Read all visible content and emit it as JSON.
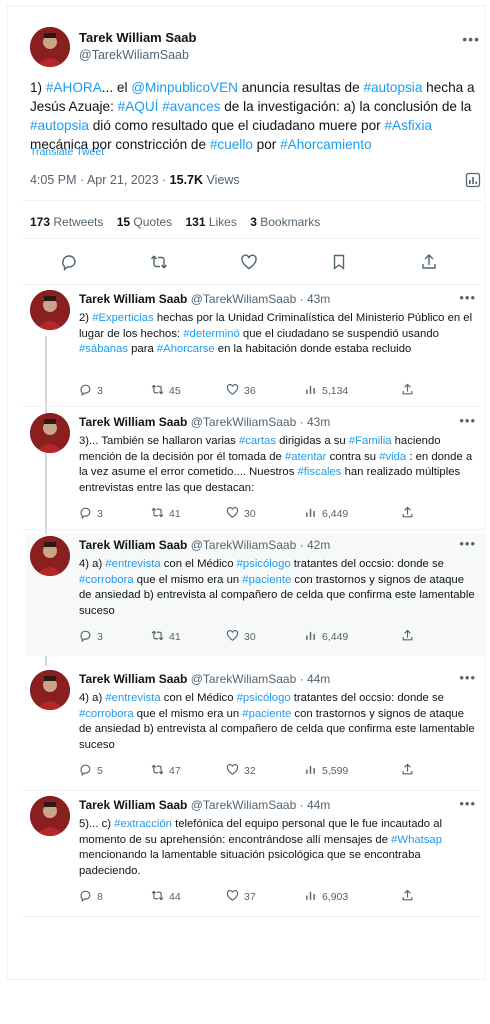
{
  "colors": {
    "accent": "#1d9bf0",
    "secondary_text": "#536471",
    "text": "#0f1419",
    "divider": "#eff3f4",
    "avatar": "#7a1d1d"
  },
  "main_tweet": {
    "author_name": "Tarek William Saab",
    "author_handle": "@TarekWiliamSaab",
    "more_icon": "ellipsis-icon",
    "text_parts": [
      {
        "t": "1) ",
        "h": false
      },
      {
        "t": "#AHORA",
        "h": true
      },
      {
        "t": "... el ",
        "h": false
      },
      {
        "t": "@MinpublicoVEN",
        "h": true
      },
      {
        "t": " anuncia resultas de ",
        "h": false
      },
      {
        "t": "#autopsia",
        "h": true
      },
      {
        "t": " hecha a Jesús Azuaje: ",
        "h": false
      },
      {
        "t": "#AQUÍ",
        "h": true
      },
      {
        "t": " ",
        "h": false
      },
      {
        "t": "#avances",
        "h": true
      },
      {
        "t": " de la investigación: a) la conclusión de la ",
        "h": false
      },
      {
        "t": "#autopsia",
        "h": true
      },
      {
        "t": " dió como resultado que el ciudadano muere por ",
        "h": false
      },
      {
        "t": "#Asfixia",
        "h": true
      },
      {
        "t": " mecánica por constricción de ",
        "h": false
      },
      {
        "t": "#cuello",
        "h": true
      },
      {
        "t": " por ",
        "h": false
      },
      {
        "t": "#Ahorcamiento",
        "h": true
      }
    ],
    "translate_label": "Translate Tweet",
    "time": "4:05 PM · Apr 21, 2023 · ",
    "views_count": "15.7K",
    "views_label": " Views",
    "stats": {
      "retweets_count": "173",
      "retweets_label": " Retweets",
      "quotes_count": "15",
      "quotes_label": " Quotes",
      "likes_count": "131",
      "likes_label": " Likes",
      "bookmarks_count": "3",
      "bookmarks_label": " Bookmarks"
    }
  },
  "replies": [
    {
      "name": "Tarek William Saab",
      "handle": "@TarekWiliamSaab · 43m",
      "text_parts": [
        {
          "t": "2) ",
          "h": false
        },
        {
          "t": "#Experticias",
          "h": true
        },
        {
          "t": " hechas por la Unidad Criminalística del Ministerio Público en el lugar de los hechos: ",
          "h": false
        },
        {
          "t": "#determinó",
          "h": true
        },
        {
          "t": " que el ciudadano se suspendió usando ",
          "h": false
        },
        {
          "t": "#sábanas",
          "h": true
        },
        {
          "t": " para ",
          "h": false
        },
        {
          "t": "#Ahorcarse",
          "h": true
        },
        {
          "t": " en la habitación donde estaba recluido",
          "h": false
        }
      ],
      "replies": "3",
      "retweets": "45",
      "likes": "36",
      "views": "5,134"
    },
    {
      "name": "Tarek William Saab",
      "handle": "@TarekWiliamSaab · 43m",
      "text_parts": [
        {
          "t": "3)... También se hallaron varias ",
          "h": false
        },
        {
          "t": "#cartas",
          "h": true
        },
        {
          "t": " dirigidas a su ",
          "h": false
        },
        {
          "t": "#Familia",
          "h": true
        },
        {
          "t": " haciendo mención de la decisión por él tomada de ",
          "h": false
        },
        {
          "t": "#atentar",
          "h": true
        },
        {
          "t": " contra su ",
          "h": false
        },
        {
          "t": "#vida",
          "h": true
        },
        {
          "t": " : en donde a la vez asume el error cometido.... Nuestros ",
          "h": false
        },
        {
          "t": "#fiscales",
          "h": true
        },
        {
          "t": " han realizado múltiples entrevistas entre las que destacan:",
          "h": false
        }
      ],
      "replies": "3",
      "retweets": "41",
      "likes": "30",
      "views": "6,449"
    },
    {
      "name": "Tarek William Saab",
      "handle": "@TarekWiliamSaab · 42m",
      "text_parts": [
        {
          "t": "4) a) ",
          "h": false
        },
        {
          "t": "#entrevista",
          "h": true
        },
        {
          "t": " con el Médico ",
          "h": false
        },
        {
          "t": "#psicólogo",
          "h": true
        },
        {
          "t": " tratantes del occsio: donde se ",
          "h": false
        },
        {
          "t": "#corrobora",
          "h": true
        },
        {
          "t": " que el mismo era un ",
          "h": false
        },
        {
          "t": "#paciente",
          "h": true
        },
        {
          "t": " con trastornos y signos de ataque de ansiedad b) entrevista al compañero de celda que confirma este lamentable suceso",
          "h": false
        }
      ],
      "replies": "3",
      "retweets": "41",
      "likes": "30",
      "views": "6,449"
    },
    {
      "name": "Tarek William Saab",
      "handle": "@TarekWiliamSaab · 44m",
      "text_parts": [
        {
          "t": "4) a) ",
          "h": false
        },
        {
          "t": "#entrevista",
          "h": true
        },
        {
          "t": " con el Médico ",
          "h": false
        },
        {
          "t": "#psicólogo",
          "h": true
        },
        {
          "t": " tratantes del occsio: donde se ",
          "h": false
        },
        {
          "t": "#corrobora",
          "h": true
        },
        {
          "t": " que el mismo era un ",
          "h": false
        },
        {
          "t": "#paciente",
          "h": true
        },
        {
          "t": " con trastornos y signos de ataque de ansiedad b) entrevista al compañero de celda que confirma este lamentable suceso",
          "h": false
        }
      ],
      "replies": "5",
      "retweets": "47",
      "likes": "32",
      "views": "5,599"
    },
    {
      "name": "Tarek William Saab",
      "handle": "@TarekWiliamSaab · 44m",
      "text_parts": [
        {
          "t": "5)... c) ",
          "h": false
        },
        {
          "t": "#extracción",
          "h": true
        },
        {
          "t": " telefónica del equipo personal que le fue incautado al momento de su aprehensión: encontrándose allí mensajes de ",
          "h": false
        },
        {
          "t": "#Whatsap",
          "h": true
        },
        {
          "t": " mencionando la lamentable situación psicológica que se encontraba padeciendo.",
          "h": false
        }
      ],
      "replies": "8",
      "retweets": "44",
      "likes": "37",
      "views": "6,903"
    }
  ]
}
